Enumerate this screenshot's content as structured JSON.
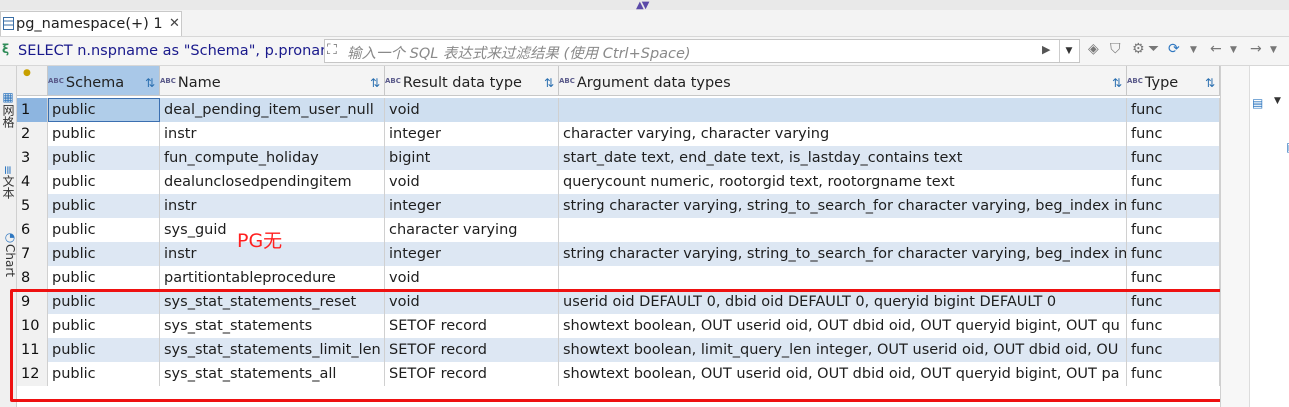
{
  "tab": {
    "label": "pg_namespace(+) 1",
    "close": "✕"
  },
  "filterbar": {
    "sql_icon": "ξ",
    "sql_text": "SELECT n.nspname as \"Schema\", p.pronar",
    "filter_placeholder": "输入一个 SQL 表达式来过滤结果 (使用 Ctrl+Space)"
  },
  "left_tabs": {
    "grid": "网格",
    "text": "文本",
    "chart": "Chart"
  },
  "columns": [
    {
      "label": "Schema"
    },
    {
      "label": "Name"
    },
    {
      "label": "Result data type"
    },
    {
      "label": "Argument data types"
    },
    {
      "label": "Type"
    }
  ],
  "rows": [
    {
      "n": "1",
      "schema": "public",
      "name": "deal_pending_item_user_null",
      "result": "void",
      "args": "",
      "type": "func"
    },
    {
      "n": "2",
      "schema": "public",
      "name": "instr",
      "result": "integer",
      "args": "character varying, character varying",
      "type": "func"
    },
    {
      "n": "3",
      "schema": "public",
      "name": "fun_compute_holiday",
      "result": "bigint",
      "args": "start_date text, end_date text, is_lastday_contains text",
      "type": "func"
    },
    {
      "n": "4",
      "schema": "public",
      "name": "dealunclosedpendingitem",
      "result": "void",
      "args": "querycount numeric, rootorgid text, rootorgname text",
      "type": "func"
    },
    {
      "n": "5",
      "schema": "public",
      "name": "instr",
      "result": "integer",
      "args": "string character varying, string_to_search_for character varying, beg_index int",
      "type": "func"
    },
    {
      "n": "6",
      "schema": "public",
      "name": "sys_guid",
      "result": "character varying",
      "args": "",
      "type": "func"
    },
    {
      "n": "7",
      "schema": "public",
      "name": "instr",
      "result": "integer",
      "args": "string character varying, string_to_search_for character varying, beg_index int",
      "type": "func"
    },
    {
      "n": "8",
      "schema": "public",
      "name": "partitiontableprocedure",
      "result": "void",
      "args": "",
      "type": "func"
    },
    {
      "n": "9",
      "schema": "public",
      "name": "sys_stat_statements_reset",
      "result": "void",
      "args": "userid oid DEFAULT 0, dbid oid DEFAULT 0, queryid bigint DEFAULT 0",
      "type": "func"
    },
    {
      "n": "10",
      "schema": "public",
      "name": "sys_stat_statements",
      "result": "SETOF record",
      "args": "showtext boolean, OUT userid oid, OUT dbid oid, OUT queryid bigint, OUT qu",
      "type": "func"
    },
    {
      "n": "11",
      "schema": "public",
      "name": "sys_stat_statements_limit_len",
      "result": "SETOF record",
      "args": "showtext boolean, limit_query_len integer, OUT userid oid, OUT dbid oid, OU",
      "type": "func"
    },
    {
      "n": "12",
      "schema": "public",
      "name": "sys_stat_statements_all",
      "result": "SETOF record",
      "args": "showtext boolean, OUT userid oid, OUT dbid oid, OUT queryid bigint, OUT pa",
      "type": "func"
    }
  ],
  "annotation": "PG无",
  "colors": {
    "annotation": "#ff2020",
    "row_alt": "#dde7f3",
    "selection": "#8db5e0"
  }
}
